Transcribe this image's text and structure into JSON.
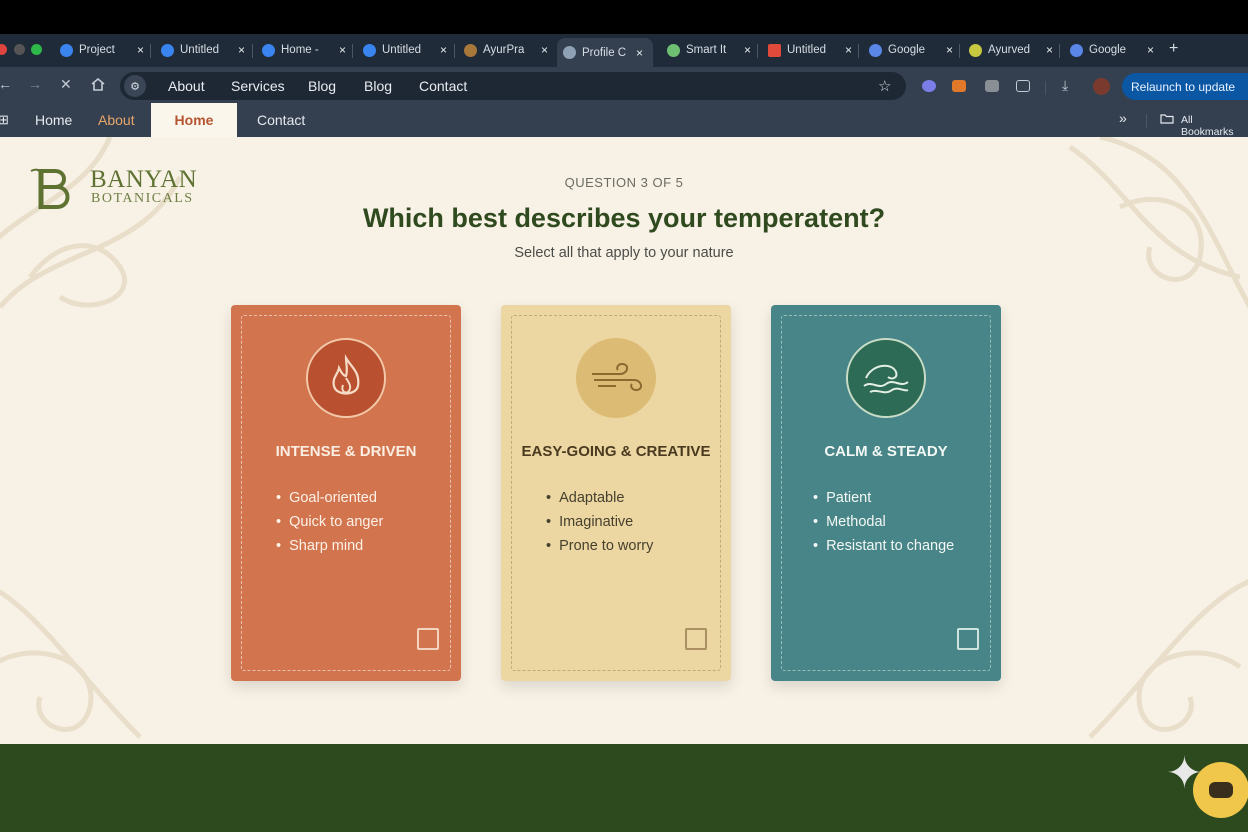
{
  "browser": {
    "tabs": [
      {
        "label": "Project",
        "color": "#3a84f0"
      },
      {
        "label": "Untitled",
        "color": "#3a84f0"
      },
      {
        "label": "Home -",
        "color": "#3a84f0"
      },
      {
        "label": "Untitled",
        "color": "#3a84f0"
      },
      {
        "label": "AyurPra",
        "color": "#a8773a"
      },
      {
        "label": "Profile C",
        "color": "#8fa1b5"
      },
      {
        "label": "Smart It",
        "color": "#6fbf73"
      },
      {
        "label": "Untitled",
        "color": "#e04a3a"
      },
      {
        "label": "Google",
        "color": "#5a86e8"
      },
      {
        "label": "Ayurved",
        "color": "#c8c840"
      },
      {
        "label": "Google",
        "color": "#5a86e8"
      }
    ],
    "tab_close": "×",
    "new_tab": "+",
    "address_links": [
      "About",
      "Services",
      "Blog",
      "Blog",
      "Contact"
    ],
    "relaunch_label": "Relaunch to update",
    "bookmarks": {
      "home": "Home",
      "about": "About",
      "active": "Home",
      "contact": "Contact",
      "more": "»",
      "all_bookmarks": "All Bookmarks"
    }
  },
  "brand": {
    "logo_letter": "B",
    "line1": "BANYAN",
    "line2": "BOTANICALS"
  },
  "quiz": {
    "progress": "QUESTION 3 OF 5",
    "title": "Which best describes your temperatent?",
    "subtitle": "Select all that apply to your nature",
    "options": [
      {
        "title": "INTENSE & DRIVEN",
        "traits": [
          "Goal-oriented",
          "Quick to anger",
          "Sharp mind"
        ],
        "icon": "flame-icon",
        "bg": "#d2744e",
        "checked": false
      },
      {
        "title": "EASY-GOING & CREATIVE",
        "traits": [
          "Adaptable",
          "Imaginative",
          "Prone to worry"
        ],
        "icon": "wind-icon",
        "bg": "#ecd7a3",
        "checked": false
      },
      {
        "title": "CALM & STEADY",
        "traits": [
          "Patient",
          "Methodal",
          "Resistant to change"
        ],
        "icon": "wave-icon",
        "bg": "#488588",
        "checked": false
      }
    ]
  }
}
